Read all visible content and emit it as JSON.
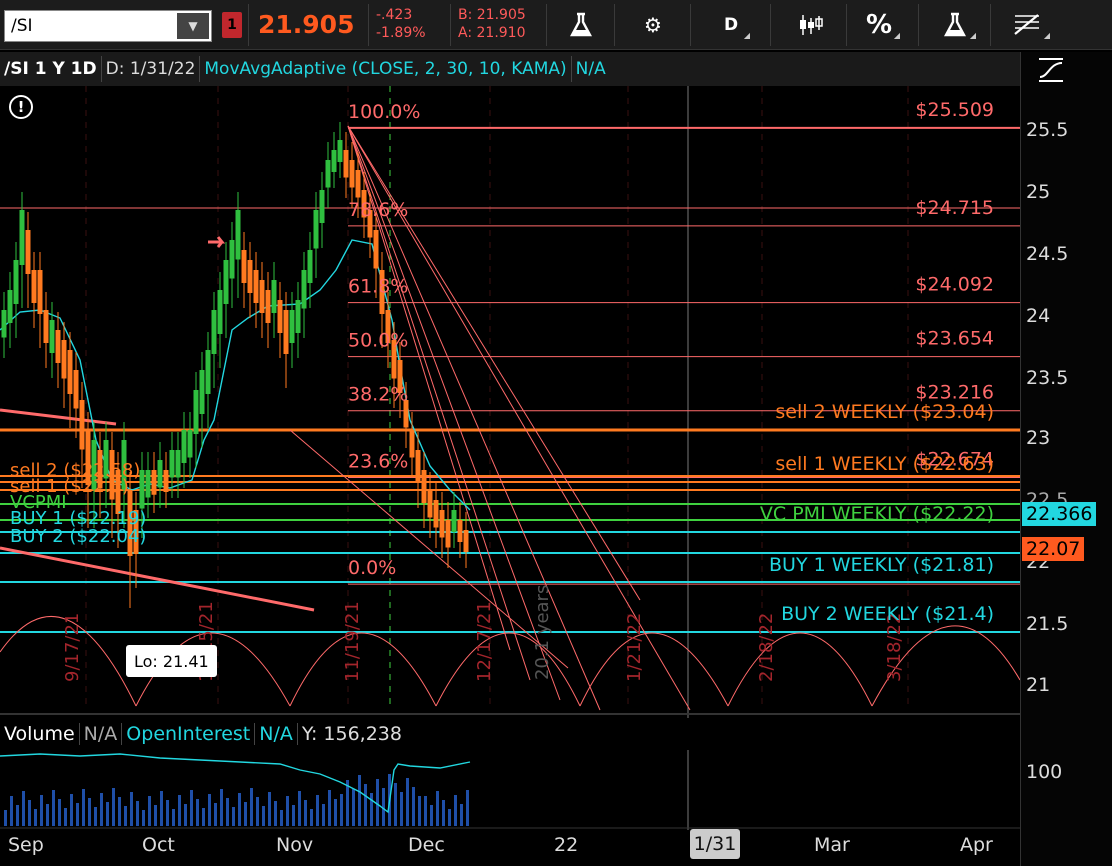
{
  "toolbar": {
    "symbol": "/SI",
    "alert_badge": "1",
    "last_price": "21.905",
    "net_change": "-.423",
    "pct_change": "-1.89%",
    "bid": "B: 21.905",
    "ask": "A: 21.910",
    "aggregation": "D",
    "percent_label": "%"
  },
  "chart_header": {
    "symbol_period": "/SI 1 Y 1D",
    "date": "D: 1/31/22",
    "study": "MovAvgAdaptive (CLOSE, 2, 30, 10, KAMA)",
    "study_value": "N/A"
  },
  "fib": {
    "levels": [
      {
        "pct": "100.0%",
        "price": "$25.509",
        "value": 25.509
      },
      {
        "pct": "78.6%",
        "price": "$24.715",
        "value": 24.715
      },
      {
        "pct": "61.8%",
        "price": "$24.092",
        "value": 24.092
      },
      {
        "pct": "50.0%",
        "price": "$23.654",
        "value": 23.654
      },
      {
        "pct": "38.2%",
        "price": "$23.216",
        "value": 23.216
      },
      {
        "pct": "23.6%",
        "price": "$22.674",
        "value": 22.674
      },
      {
        "pct": "0.0%",
        "price": "$21.81",
        "value": 21.81
      }
    ]
  },
  "levels": {
    "sell2_weekly": "sell 2 WEEKLY ($23.04)",
    "sell1_weekly": "sell 1 WEEKLY ($22.63)",
    "vcpmi_weekly": "VC PMI WEEKLY ($22.22)",
    "buy1_weekly": "BUY 1 WEEKLY ($21.81)",
    "buy2_weekly": "BUY 2 WEEKLY ($21.4)",
    "sell2_daily": "sell 2 ($22.58)",
    "sell1_daily": "sell 1 ($22.5)",
    "vcpmi_daily": "VCPMI",
    "buy1_daily": "BUY 1 ($22.19)",
    "buy2_daily": "BUY 2 ($22.04)"
  },
  "lo_label": "Lo: 21.41",
  "price_axis": {
    "ticks": [
      "25.5",
      "25",
      "24.5",
      "24",
      "23.5",
      "23",
      "22.5",
      "22",
      "21.5",
      "21"
    ],
    "kama_badge": "22.366",
    "last_badge": "22.07",
    "volume_tick": "100"
  },
  "volume_header": {
    "volume_label": "Volume",
    "volume_value": "N/A",
    "oi_label": "OpenInterest",
    "oi_value": "N/A",
    "y_value": "Y: 156,238"
  },
  "date_axis": {
    "labels": [
      "Sep",
      "Oct",
      "Nov",
      "Dec",
      "22",
      "Mar",
      "Apr"
    ],
    "cursor": "1/31"
  },
  "vertical_dates": [
    "9/17/21",
    "10/15/21",
    "11/19/21",
    "12/17/21",
    "1/21/22",
    "2/18/22",
    "3/18/22"
  ],
  "cycle_label": "20.1 years",
  "colors": {
    "fib": "#ff6a6a",
    "orange": "#ff7a20",
    "cyan": "#22d7e0",
    "green": "#3fd13f",
    "up_candle": "#2fbf3f",
    "down_candle": "#ff7a20"
  }
}
